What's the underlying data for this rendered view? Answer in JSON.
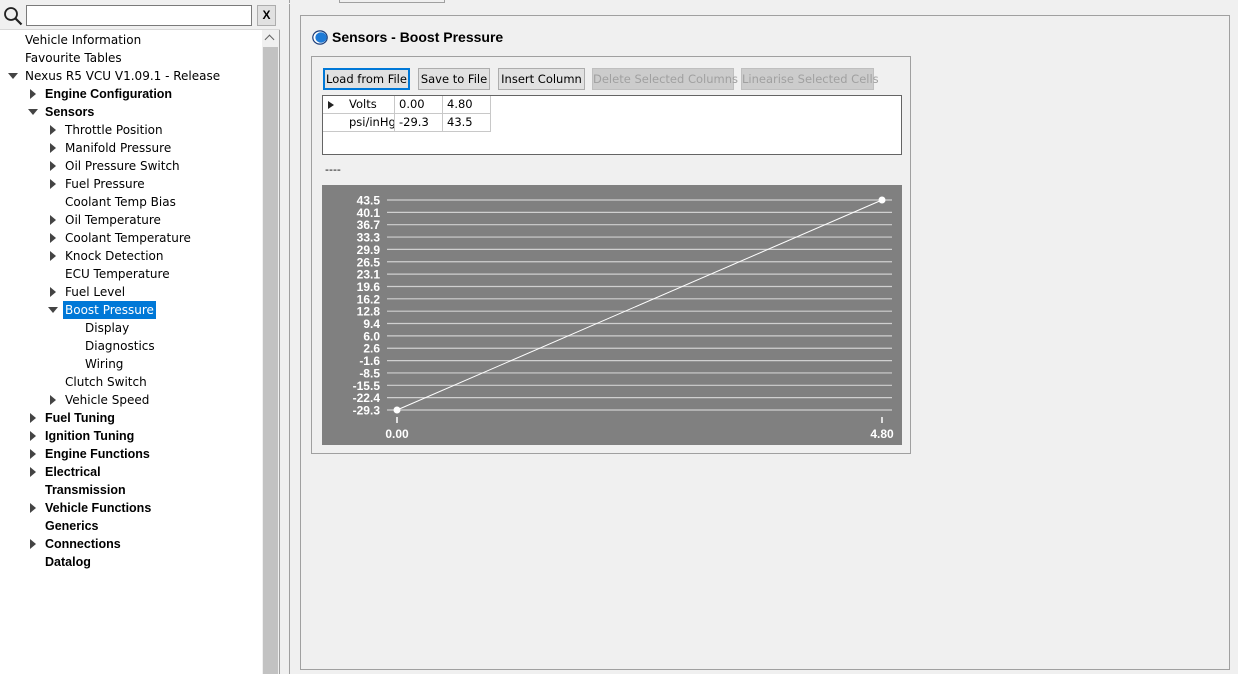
{
  "search": {
    "value": "",
    "placeholder": "",
    "clear_label": "X"
  },
  "tree": [
    {
      "label": "Vehicle Information",
      "indent": 0,
      "arrow": "none",
      "bold": false,
      "selected": false
    },
    {
      "label": "Favourite Tables",
      "indent": 0,
      "arrow": "none",
      "bold": false,
      "selected": false
    },
    {
      "label": "Nexus R5 VCU V1.09.1 - Release",
      "indent": 0,
      "arrow": "down",
      "bold": false,
      "selected": false
    },
    {
      "label": "Engine Configuration",
      "indent": 1,
      "arrow": "right",
      "bold": true,
      "selected": false
    },
    {
      "label": "Sensors",
      "indent": 1,
      "arrow": "down",
      "bold": true,
      "selected": false
    },
    {
      "label": "Throttle Position",
      "indent": 2,
      "arrow": "right",
      "bold": false,
      "selected": false
    },
    {
      "label": "Manifold Pressure",
      "indent": 2,
      "arrow": "right",
      "bold": false,
      "selected": false
    },
    {
      "label": "Oil Pressure Switch",
      "indent": 2,
      "arrow": "right",
      "bold": false,
      "selected": false
    },
    {
      "label": "Fuel Pressure",
      "indent": 2,
      "arrow": "right",
      "bold": false,
      "selected": false
    },
    {
      "label": "Coolant Temp Bias",
      "indent": 2,
      "arrow": "none",
      "bold": false,
      "selected": false
    },
    {
      "label": "Oil Temperature",
      "indent": 2,
      "arrow": "right",
      "bold": false,
      "selected": false
    },
    {
      "label": "Coolant Temperature",
      "indent": 2,
      "arrow": "right",
      "bold": false,
      "selected": false
    },
    {
      "label": "Knock Detection",
      "indent": 2,
      "arrow": "right",
      "bold": false,
      "selected": false
    },
    {
      "label": "ECU Temperature",
      "indent": 2,
      "arrow": "none",
      "bold": false,
      "selected": false
    },
    {
      "label": "Fuel Level",
      "indent": 2,
      "arrow": "right",
      "bold": false,
      "selected": false
    },
    {
      "label": "Boost Pressure",
      "indent": 2,
      "arrow": "down",
      "bold": false,
      "selected": true
    },
    {
      "label": "Display",
      "indent": 3,
      "arrow": "none",
      "bold": false,
      "selected": false
    },
    {
      "label": "Diagnostics",
      "indent": 3,
      "arrow": "none",
      "bold": false,
      "selected": false
    },
    {
      "label": "Wiring",
      "indent": 3,
      "arrow": "none",
      "bold": false,
      "selected": false
    },
    {
      "label": "Clutch Switch",
      "indent": 2,
      "arrow": "none",
      "bold": false,
      "selected": false
    },
    {
      "label": "Vehicle Speed",
      "indent": 2,
      "arrow": "right",
      "bold": false,
      "selected": false
    },
    {
      "label": "Fuel Tuning",
      "indent": 1,
      "arrow": "right",
      "bold": true,
      "selected": false
    },
    {
      "label": "Ignition Tuning",
      "indent": 1,
      "arrow": "right",
      "bold": true,
      "selected": false
    },
    {
      "label": "Engine Functions",
      "indent": 1,
      "arrow": "right",
      "bold": true,
      "selected": false
    },
    {
      "label": "Electrical",
      "indent": 1,
      "arrow": "right",
      "bold": true,
      "selected": false
    },
    {
      "label": "Transmission",
      "indent": 1,
      "arrow": "none",
      "bold": true,
      "selected": false
    },
    {
      "label": "Vehicle Functions",
      "indent": 1,
      "arrow": "right",
      "bold": true,
      "selected": false
    },
    {
      "label": "Generics",
      "indent": 1,
      "arrow": "none",
      "bold": true,
      "selected": false
    },
    {
      "label": "Connections",
      "indent": 1,
      "arrow": "right",
      "bold": true,
      "selected": false
    },
    {
      "label": "Datalog",
      "indent": 1,
      "arrow": "none",
      "bold": true,
      "selected": false
    }
  ],
  "page": {
    "title": "Sensors - Boost Pressure"
  },
  "toolbar": {
    "load": "Load from File",
    "save": "Save to File",
    "insert": "Insert Column",
    "delete": "Delete Selected Columns",
    "linearise": "Linearise Selected Cells"
  },
  "table": {
    "rows": [
      {
        "header": "Volts",
        "cells": [
          "0.00",
          "4.80"
        ]
      },
      {
        "header": "psi/inHg",
        "cells": [
          "-29.3",
          "43.5"
        ]
      }
    ]
  },
  "status": "----",
  "colors": {
    "selection": "#0078d7",
    "chart_background": "#808080",
    "chart_line": "#ffffff"
  },
  "chart_data": {
    "type": "line",
    "x": [
      0.0,
      4.8
    ],
    "series": [
      {
        "values": [
          -29.3,
          43.5
        ]
      }
    ],
    "x_tick_labels": [
      "0.00",
      "4.80"
    ],
    "y_tick_labels": [
      "43.5",
      "40.1",
      "36.7",
      "33.3",
      "29.9",
      "26.5",
      "23.1",
      "19.6",
      "16.2",
      "12.8",
      "9.4",
      "6.0",
      "2.6",
      "-1.6",
      "-8.5",
      "-15.5",
      "-22.4",
      "-29.3"
    ],
    "xlim": [
      0.0,
      4.8
    ],
    "ylim": [
      -29.3,
      43.5
    ],
    "grid": true
  }
}
